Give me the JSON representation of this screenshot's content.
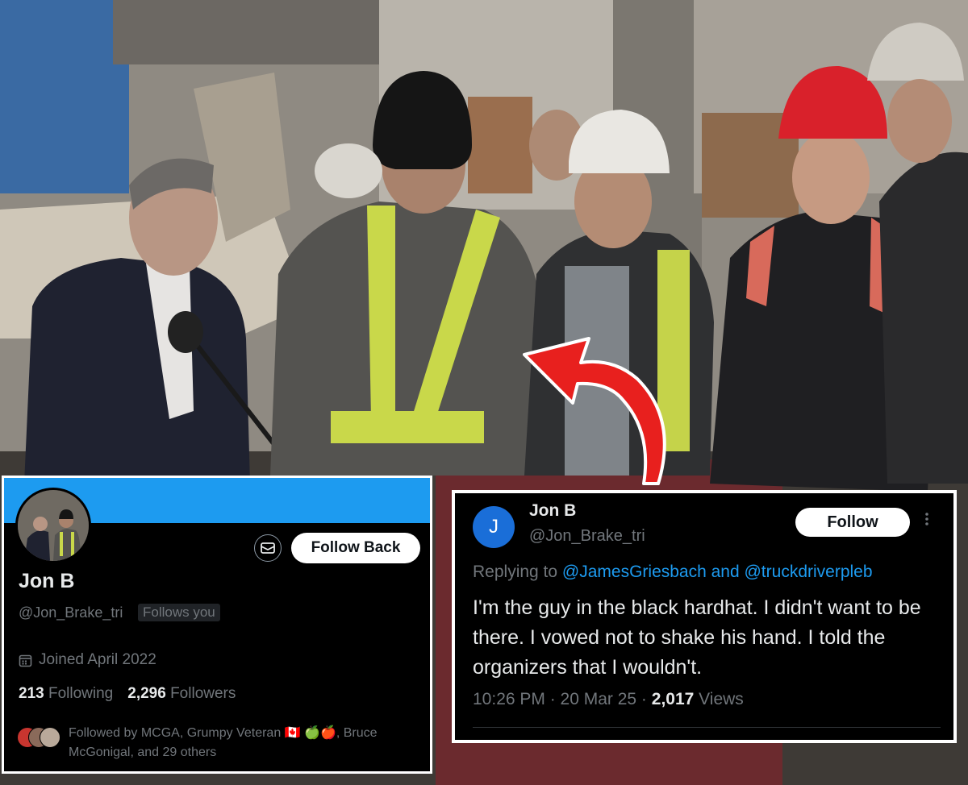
{
  "colors": {
    "banner": "#1d9bf0",
    "card_bg": "#000000",
    "primary_text": "#e7e9ea",
    "secondary_text": "#71767b",
    "link": "#1d9bf0",
    "arrow": "#e8201e"
  },
  "profile": {
    "name": "Jon B",
    "handle": "@Jon_Brake_tri",
    "follows_you": "Follows you",
    "follow_back_label": "Follow Back",
    "message_icon": "mail-icon",
    "calendar_icon": "calendar-icon",
    "joined": "Joined April 2022",
    "following_count": "213",
    "following_label": "Following",
    "followers_count": "2,296",
    "followers_label": "Followers",
    "followed_by": "Followed by MCGA, Grumpy Veteran 🇨🇦 🍏🍎, Bruce McGonigal, and 29 others"
  },
  "tweet": {
    "avatar_letter": "J",
    "name": "Jon B",
    "handle": "@Jon_Brake_tri",
    "follow_label": "Follow",
    "more_icon": "more-vertical-icon",
    "replying_prefix": "Replying to",
    "replying_mentions": "@JamesGriesbach and @truckdriverpleb",
    "body": "I'm the guy in the black hardhat. I didn't want to be there. I vowed not to shake his hand. I told the organizers that I wouldn't.",
    "time": "10:26 PM · 20 Mar 25 · ",
    "views_count": "2,017",
    "views_label": "Views"
  }
}
